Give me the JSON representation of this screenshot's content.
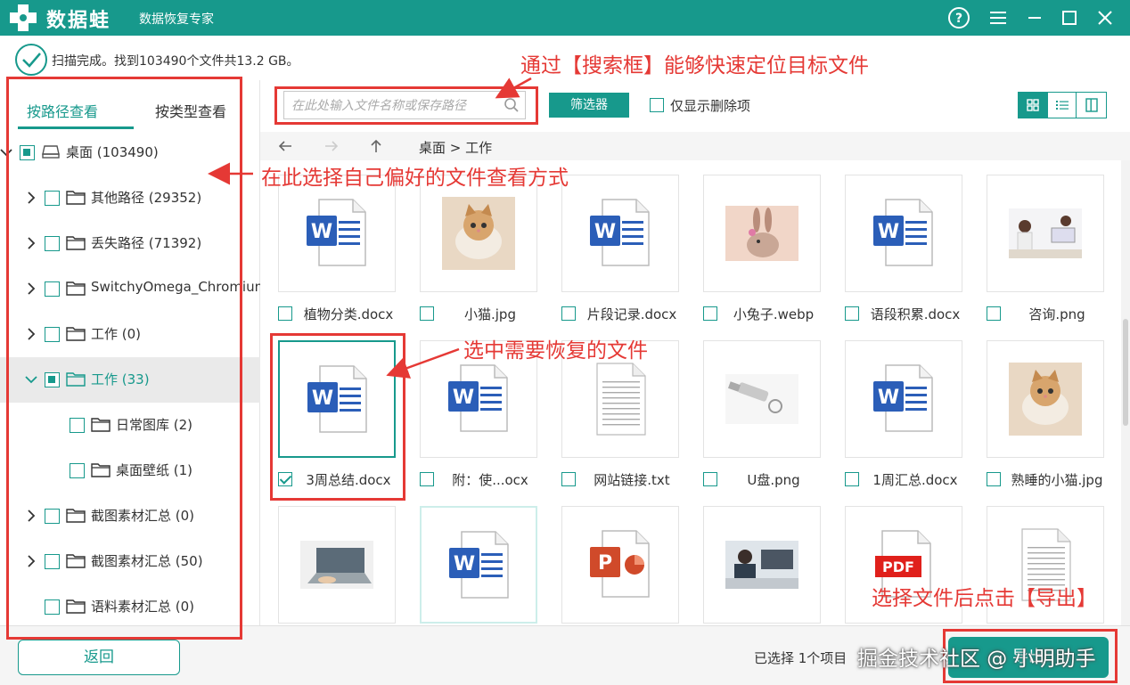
{
  "titlebar": {
    "brand": "数据蛙",
    "subtitle": "数据恢复专家"
  },
  "status": {
    "text": "扫描完成。找到103490个文件共13.2 GB。"
  },
  "tabs": {
    "by_path": "按路径查看",
    "by_type": "按类型查看"
  },
  "tree": [
    {
      "label": "桌面 (103490)"
    },
    {
      "label": "其他路径 (29352)"
    },
    {
      "label": "丢失路径 (71392)"
    },
    {
      "label": "SwitchyOmega_Chromium"
    },
    {
      "label": "工作 (0)"
    },
    {
      "label": "工作 (33)"
    },
    {
      "label": "日常图库 (2)"
    },
    {
      "label": "桌面壁纸 (1)"
    },
    {
      "label": "截图素材汇总 (0)"
    },
    {
      "label": "截图素材汇总 (50)"
    },
    {
      "label": "语料素材汇总 (0)"
    }
  ],
  "toolbar": {
    "search_placeholder": "在此处输入文件名称或保存路径",
    "filter_label": "筛选器",
    "only_deleted_label": "仅显示删除项"
  },
  "nav": {
    "breadcrumb": "桌面 > 工作"
  },
  "files": [
    {
      "name": "植物分类.docx",
      "kind": "word",
      "checked": false
    },
    {
      "name": "小猫.jpg",
      "kind": "cat-photo",
      "checked": false
    },
    {
      "name": "片段记录.docx",
      "kind": "word",
      "checked": false
    },
    {
      "name": "小兔子.webp",
      "kind": "rabbit-photo",
      "checked": false
    },
    {
      "name": "语段积累.docx",
      "kind": "word",
      "checked": false
    },
    {
      "name": "咨询.png",
      "kind": "office-photo",
      "checked": false
    },
    {
      "name": "3周总结.docx",
      "kind": "word",
      "checked": true
    },
    {
      "name": "附：使...ocx",
      "kind": "word",
      "checked": false
    },
    {
      "name": "网站链接.txt",
      "kind": "text",
      "checked": false
    },
    {
      "name": "U盘.png",
      "kind": "usb-photo",
      "checked": false
    },
    {
      "name": "1周汇总.docx",
      "kind": "word",
      "checked": false
    },
    {
      "name": "熟睡的小猫.jpg",
      "kind": "cat-photo",
      "checked": false
    },
    {
      "name": "",
      "kind": "laptop-photo"
    },
    {
      "name": "",
      "kind": "word"
    },
    {
      "name": "",
      "kind": "ppt"
    },
    {
      "name": "",
      "kind": "work-photo"
    },
    {
      "name": "",
      "kind": "pdf"
    },
    {
      "name": "",
      "kind": "text"
    }
  ],
  "bottom": {
    "back_label": "返回",
    "selected_info": "已选择 1个项目",
    "export_label": "导出"
  },
  "annotations": {
    "search": "通过【搜索框】能够快速定位目标文件",
    "view_mode": "在此选择自己偏好的文件查看方式",
    "select": "选中需要恢复的文件",
    "export": "选择文件后点击【导出】"
  },
  "watermark": "掘金技术社区 @ 小明助手",
  "colors": {
    "accent": "#17998c",
    "annotation": "#e53935",
    "word_blue": "#2b5eb8",
    "ppt_orange": "#d04a2a",
    "pdf_red": "#e0201b"
  }
}
